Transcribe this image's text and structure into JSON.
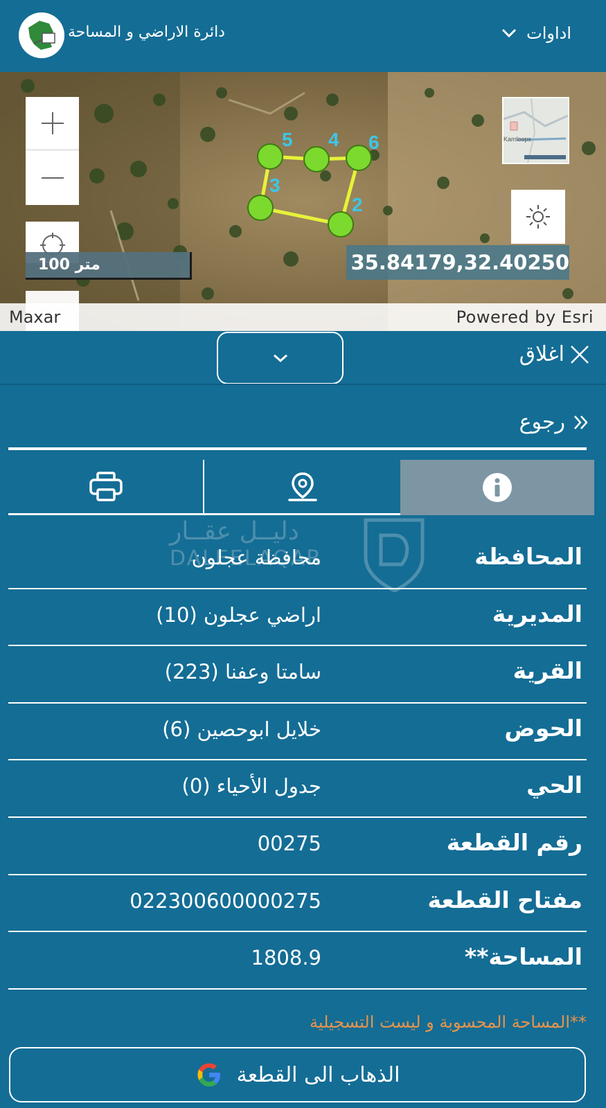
{
  "header": {
    "app_title": "دائرة الاراضي و المساحة",
    "tools_label": "اداوات",
    "tools_icon": "chevron-down-icon",
    "logo_icon": "jordan-map-logo-icon"
  },
  "map": {
    "scale_label": "100 متر",
    "coordinates": "35.84179,32.40250",
    "attribution_left": "Maxar",
    "attribution_right": "Powered by Esri",
    "minimap_place": "Kamloops",
    "vertex_labels": [
      "2",
      "3",
      "4",
      "5",
      "6"
    ],
    "parcel_color": "#e6f23a",
    "vertex_color": "#7cd92e"
  },
  "panel": {
    "close_label": "اغلاق",
    "back_label": "رجوع",
    "tabs": [
      {
        "name": "info",
        "icon": "info-icon",
        "active": true
      },
      {
        "name": "location",
        "icon": "location-pin-icon",
        "active": false
      },
      {
        "name": "print",
        "icon": "printer-icon",
        "active": false
      }
    ]
  },
  "parcel_info": [
    {
      "label": "المحافظة",
      "value": "محافظة عجلون"
    },
    {
      "label": "المديرية",
      "value": "اراضي عجلون (10)"
    },
    {
      "label": "القرية",
      "value": "سامتا وعفنا (223)"
    },
    {
      "label": "الحوض",
      "value": "خلايل ابوحصين (6)"
    },
    {
      "label": "الحي",
      "value": "جدول الأحياء (0)"
    },
    {
      "label": "رقم القطعة",
      "value": "00275"
    },
    {
      "label": "مفتاح القطعة",
      "value": "022300600000275"
    },
    {
      "label": "المساحة**",
      "value": "1808.9"
    }
  ],
  "watermark": {
    "arabic": "دليــل عقــار",
    "latin": "DALEELAQAR"
  },
  "footnote": "**المساحة المحسوبة و ليست التسجيلية",
  "go_button": {
    "label": "الذهاب الى القطعة",
    "icon": "google-icon"
  },
  "colors": {
    "background": "#146d95",
    "active_tab": "#7d96a3",
    "footnote": "#e8934a"
  }
}
